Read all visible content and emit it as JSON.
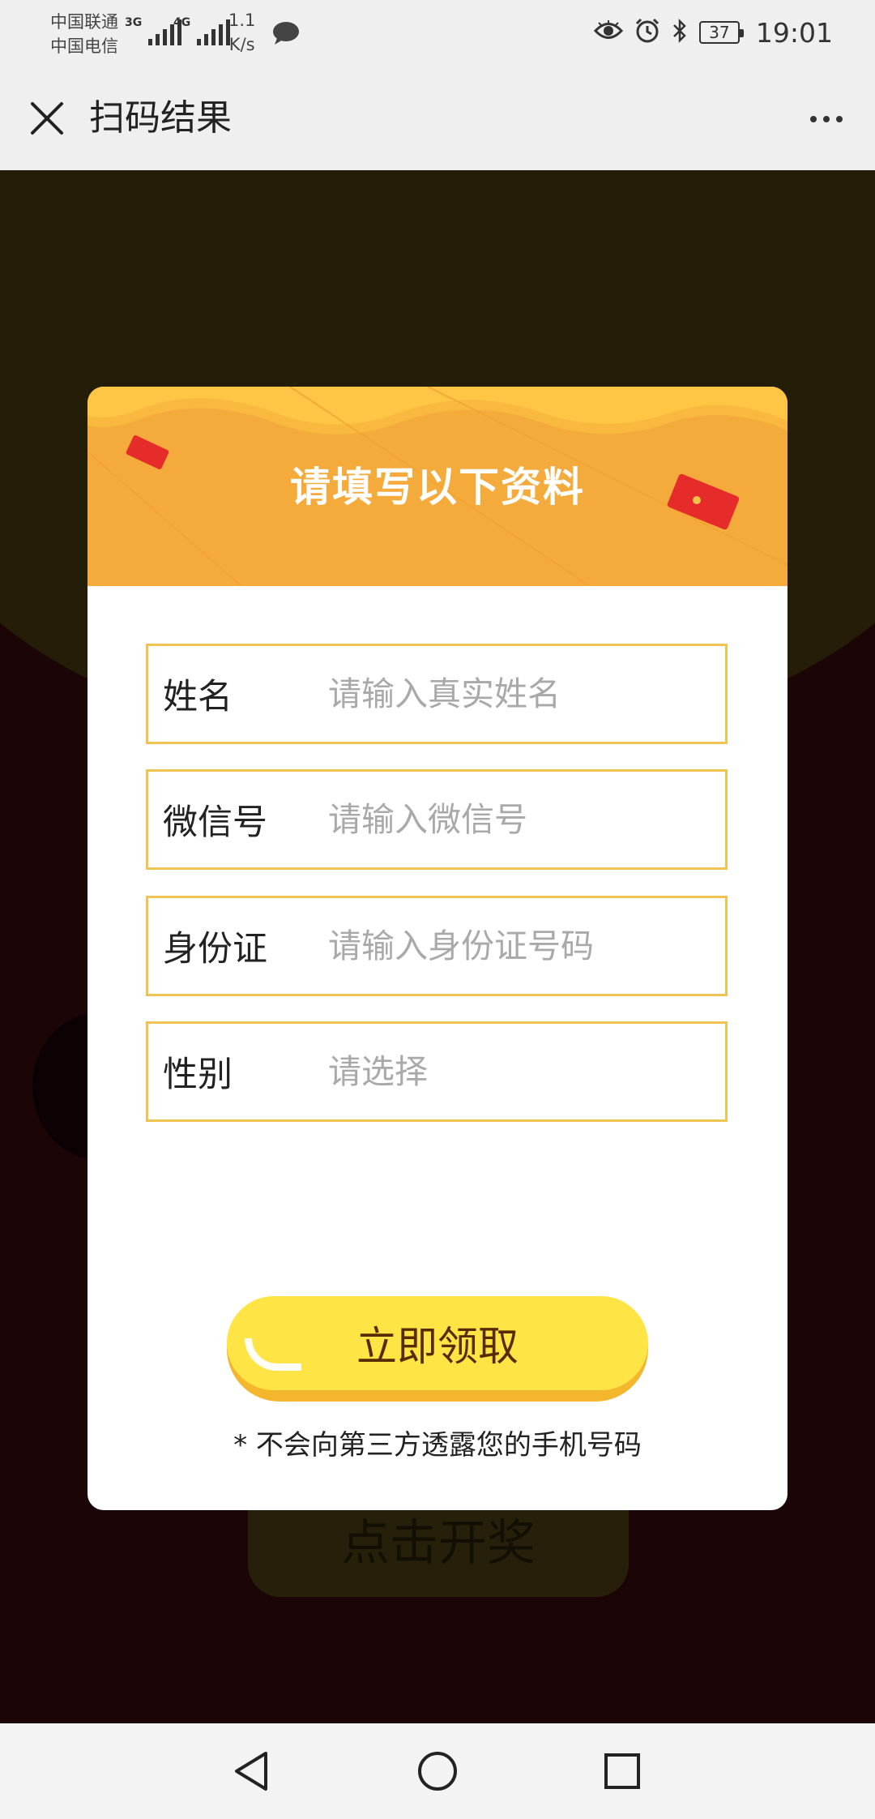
{
  "status_bar": {
    "carrier_1": "中国联通",
    "carrier_2": "中国电信",
    "signal_1_tag": "3G",
    "signal_2_tag": "4G",
    "speed_value": "1.1",
    "speed_unit": "K/s",
    "battery": "37",
    "time": "19:01"
  },
  "nav": {
    "title": "扫码结果"
  },
  "modal": {
    "title": "请填写以下资料",
    "fields": [
      {
        "label": "姓名",
        "placeholder": "请输入真实姓名"
      },
      {
        "label": "微信号",
        "placeholder": "请输入微信号"
      },
      {
        "label": "身份证",
        "placeholder": "请输入身份证号码"
      },
      {
        "label": "性别",
        "placeholder": "请选择"
      }
    ],
    "button_label": "立即领取",
    "note": "* 不会向第三方透露您的手机号码"
  },
  "background": {
    "button_text": "点击开奖"
  },
  "colors": {
    "header": "#f5ab3b",
    "field_border": "#efc452",
    "button": "#ffe446",
    "button_shadow": "#f3b62c",
    "button_text": "#5a2b00"
  }
}
